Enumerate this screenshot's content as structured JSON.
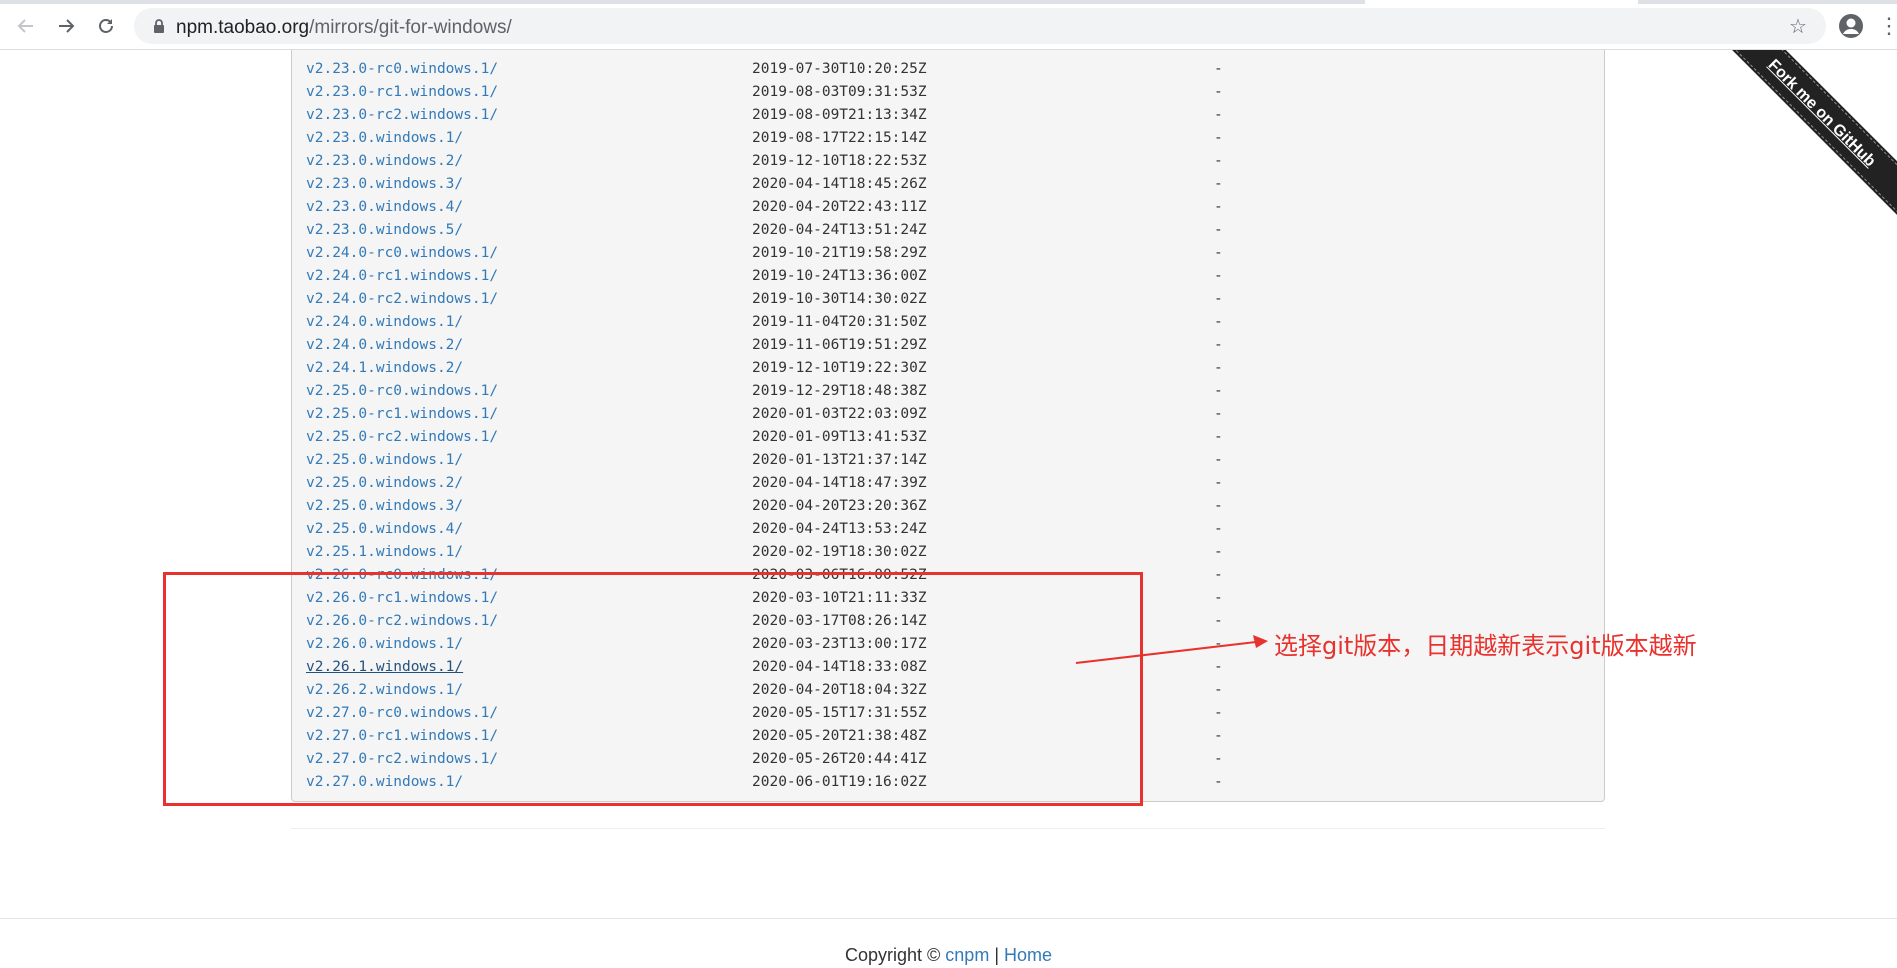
{
  "browser": {
    "url_host": "npm.taobao.org",
    "url_path": "/mirrors/git-for-windows/",
    "back_icon": "arrow-left",
    "forward_icon": "arrow-right",
    "reload_icon": "reload",
    "bookmark_icon": "star",
    "profile_icon": "account-circle",
    "menu_icon": "vertical-ellipsis"
  },
  "listing": [
    {
      "name": "v2.23.0-rc0.windows.1/",
      "date": "2019-07-30T10:20:25Z",
      "size": "-"
    },
    {
      "name": "v2.23.0-rc1.windows.1/",
      "date": "2019-08-03T09:31:53Z",
      "size": "-"
    },
    {
      "name": "v2.23.0-rc2.windows.1/",
      "date": "2019-08-09T21:13:34Z",
      "size": "-"
    },
    {
      "name": "v2.23.0.windows.1/",
      "date": "2019-08-17T22:15:14Z",
      "size": "-"
    },
    {
      "name": "v2.23.0.windows.2/",
      "date": "2019-12-10T18:22:53Z",
      "size": "-"
    },
    {
      "name": "v2.23.0.windows.3/",
      "date": "2020-04-14T18:45:26Z",
      "size": "-"
    },
    {
      "name": "v2.23.0.windows.4/",
      "date": "2020-04-20T22:43:11Z",
      "size": "-"
    },
    {
      "name": "v2.23.0.windows.5/",
      "date": "2020-04-24T13:51:24Z",
      "size": "-"
    },
    {
      "name": "v2.24.0-rc0.windows.1/",
      "date": "2019-10-21T19:58:29Z",
      "size": "-"
    },
    {
      "name": "v2.24.0-rc1.windows.1/",
      "date": "2019-10-24T13:36:00Z",
      "size": "-"
    },
    {
      "name": "v2.24.0-rc2.windows.1/",
      "date": "2019-10-30T14:30:02Z",
      "size": "-"
    },
    {
      "name": "v2.24.0.windows.1/",
      "date": "2019-11-04T20:31:50Z",
      "size": "-"
    },
    {
      "name": "v2.24.0.windows.2/",
      "date": "2019-11-06T19:51:29Z",
      "size": "-"
    },
    {
      "name": "v2.24.1.windows.2/",
      "date": "2019-12-10T19:22:30Z",
      "size": "-"
    },
    {
      "name": "v2.25.0-rc0.windows.1/",
      "date": "2019-12-29T18:48:38Z",
      "size": "-"
    },
    {
      "name": "v2.25.0-rc1.windows.1/",
      "date": "2020-01-03T22:03:09Z",
      "size": "-"
    },
    {
      "name": "v2.25.0-rc2.windows.1/",
      "date": "2020-01-09T13:41:53Z",
      "size": "-"
    },
    {
      "name": "v2.25.0.windows.1/",
      "date": "2020-01-13T21:37:14Z",
      "size": "-"
    },
    {
      "name": "v2.25.0.windows.2/",
      "date": "2020-04-14T18:47:39Z",
      "size": "-"
    },
    {
      "name": "v2.25.0.windows.3/",
      "date": "2020-04-20T23:20:36Z",
      "size": "-"
    },
    {
      "name": "v2.25.0.windows.4/",
      "date": "2020-04-24T13:53:24Z",
      "size": "-"
    },
    {
      "name": "v2.25.1.windows.1/",
      "date": "2020-02-19T18:30:02Z",
      "size": "-"
    },
    {
      "name": "v2.26.0-rc0.windows.1/",
      "date": "2020-03-06T16:00:52Z",
      "size": "-"
    },
    {
      "name": "v2.26.0-rc1.windows.1/",
      "date": "2020-03-10T21:11:33Z",
      "size": "-"
    },
    {
      "name": "v2.26.0-rc2.windows.1/",
      "date": "2020-03-17T08:26:14Z",
      "size": "-"
    },
    {
      "name": "v2.26.0.windows.1/",
      "date": "2020-03-23T13:00:17Z",
      "size": "-"
    },
    {
      "name": "v2.26.1.windows.1/",
      "date": "2020-04-14T18:33:08Z",
      "size": "-",
      "hovered": true
    },
    {
      "name": "v2.26.2.windows.1/",
      "date": "2020-04-20T18:04:32Z",
      "size": "-"
    },
    {
      "name": "v2.27.0-rc0.windows.1/",
      "date": "2020-05-15T17:31:55Z",
      "size": "-"
    },
    {
      "name": "v2.27.0-rc1.windows.1/",
      "date": "2020-05-20T21:38:48Z",
      "size": "-"
    },
    {
      "name": "v2.27.0-rc2.windows.1/",
      "date": "2020-05-26T20:44:41Z",
      "size": "-"
    },
    {
      "name": "v2.27.0.windows.1/",
      "date": "2020-06-01T19:16:02Z",
      "size": "-"
    }
  ],
  "ribbon": {
    "label": "Fork me on GitHub"
  },
  "footer": {
    "copyright": "Copyright © ",
    "link1": "cnpm",
    "separator": " | ",
    "link2": "Home"
  },
  "annotation": {
    "text": "选择git版本，日期越新表示git版本越新",
    "color": "#e8322d"
  }
}
